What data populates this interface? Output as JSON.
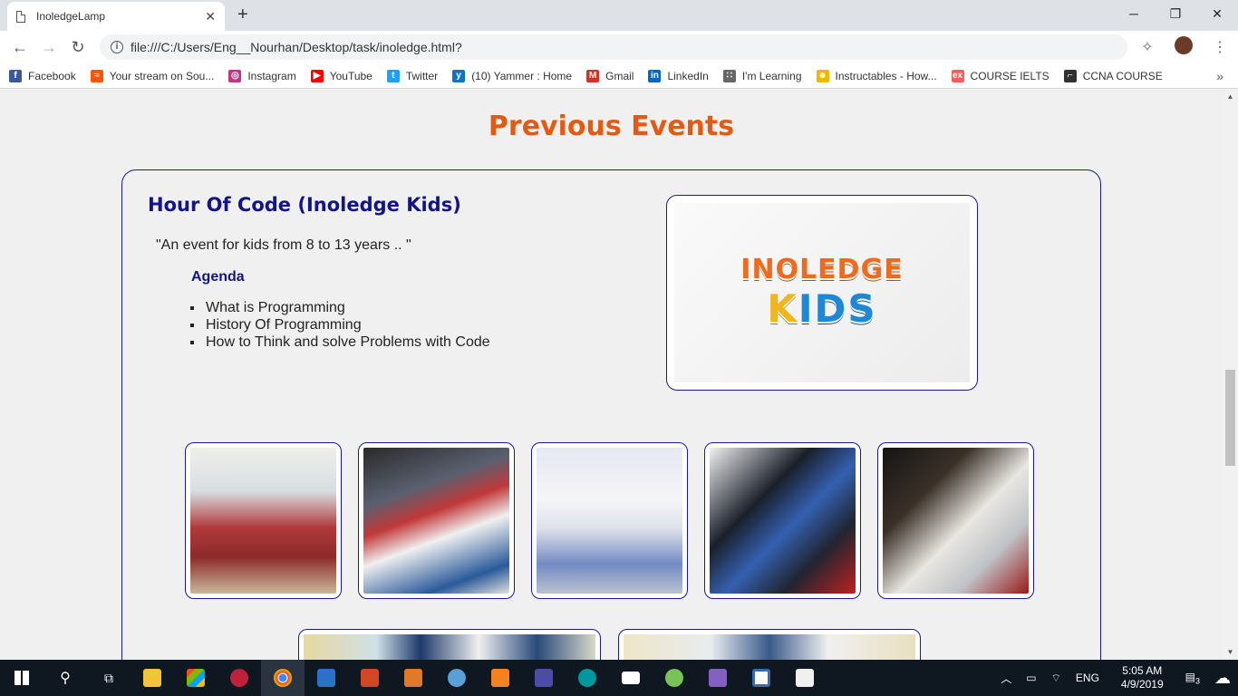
{
  "browser": {
    "tab_title": "InoledgeLamp",
    "address": "file:///C:/Users/Eng__Nourhan/Desktop/task/inoledge.html?",
    "bookmarks": [
      {
        "label": "Facebook",
        "color": "#3b5998",
        "glyph": "f"
      },
      {
        "label": "Your stream on Sou...",
        "color": "#ff5500",
        "glyph": "≈"
      },
      {
        "label": "Instagram",
        "color": "#c13584",
        "glyph": "◎"
      },
      {
        "label": "YouTube",
        "color": "#ff0000",
        "glyph": "▶"
      },
      {
        "label": "Twitter",
        "color": "#1da1f2",
        "glyph": "t"
      },
      {
        "label": "(10) Yammer : Home",
        "color": "#1173c5",
        "glyph": "y"
      },
      {
        "label": "Gmail",
        "color": "#d93025",
        "glyph": "M"
      },
      {
        "label": "LinkedIn",
        "color": "#0a66c2",
        "glyph": "in"
      },
      {
        "label": "I'm Learning",
        "color": "#666666",
        "glyph": "∷"
      },
      {
        "label": "Instructables - How...",
        "color": "#f4b400",
        "glyph": "☻"
      },
      {
        "label": "COURSE IELTS",
        "color": "#ff5a5a",
        "glyph": "ex"
      },
      {
        "label": "CCNA COURSE",
        "color": "#333333",
        "glyph": "⌐"
      }
    ]
  },
  "page": {
    "heading": "Previous Events",
    "event": {
      "title": "Hour Of Code (Inoledge Kids)",
      "quote": "\"An event for kids from 8 to 13 years .. \"",
      "agenda_label": "Agenda",
      "agenda": [
        "What is Programming",
        "History Of Programming",
        "How to Think and solve Problems with Code"
      ],
      "logo_line1": "INOLEDGE",
      "logo_line2_k": "K",
      "logo_line2_rest": "IDS"
    }
  },
  "taskbar": {
    "language": "ENG",
    "time": "5:05 AM",
    "date": "4/9/2019",
    "notifications": "3"
  }
}
